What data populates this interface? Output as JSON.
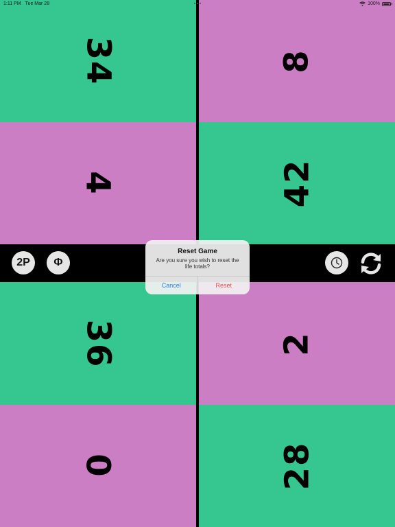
{
  "status_bar": {
    "time": "1:11 PM",
    "date": "Tue Mar 28",
    "battery": "100%"
  },
  "colors": {
    "green": "#36c690",
    "pink": "#cc7ec4",
    "divider": "#000000",
    "button_bg": "#e6e6e6"
  },
  "players": [
    {
      "life": "34",
      "color": "green"
    },
    {
      "life": "8",
      "color": "pink"
    },
    {
      "life": "4",
      "color": "pink"
    },
    {
      "life": "42",
      "color": "green"
    },
    {
      "life": "36",
      "color": "green"
    },
    {
      "life": "2",
      "color": "pink"
    },
    {
      "life": "0",
      "color": "pink"
    },
    {
      "life": "28",
      "color": "green"
    }
  ],
  "toolbar": {
    "players_label": "2P",
    "phi_label": "Φ",
    "clock_icon": "clock-icon",
    "sync_icon": "sync-icon"
  },
  "dialog": {
    "title": "Reset Game",
    "message": "Are you sure you wish to reset the life totals?",
    "cancel_label": "Cancel",
    "reset_label": "Reset"
  }
}
